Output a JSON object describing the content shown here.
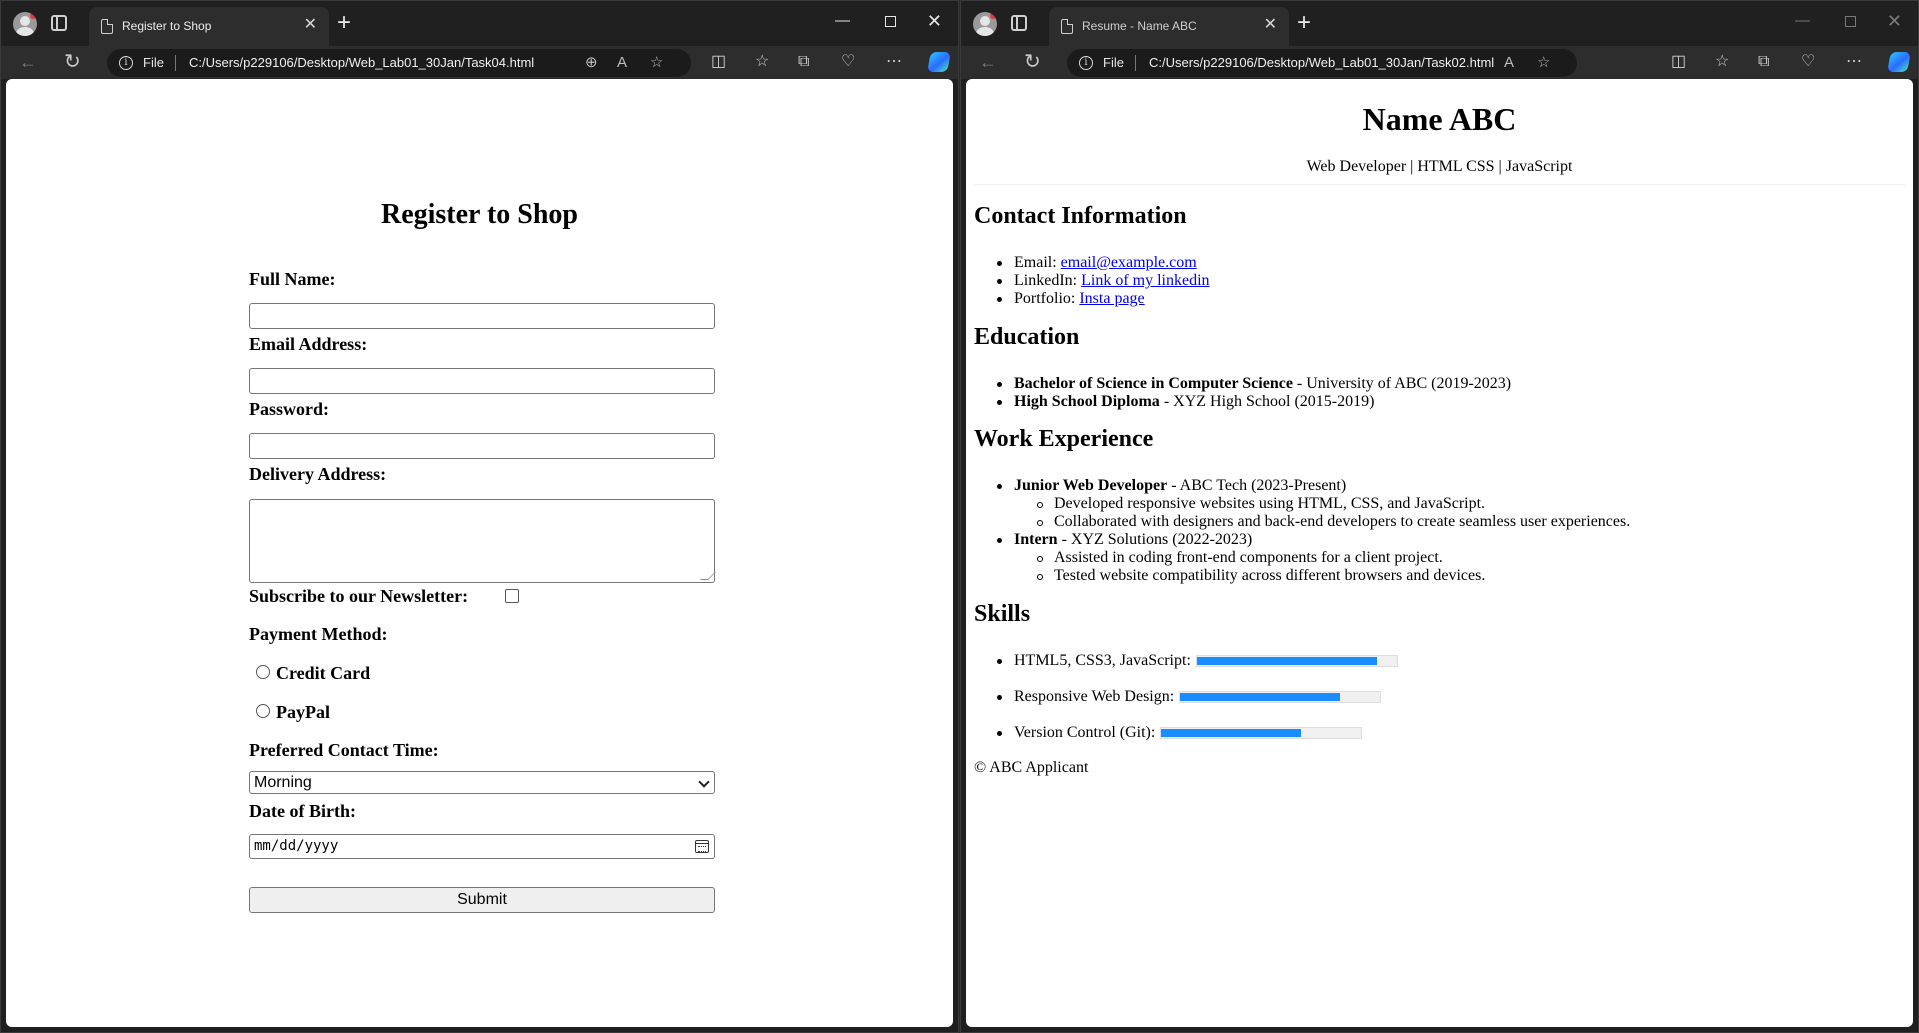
{
  "left_window": {
    "tab_title": "Register to Shop",
    "file_label": "File",
    "url": "C:/Users/p229106/Desktop/Web_Lab01_30Jan/Task04.html",
    "form": {
      "title": "Register to Shop",
      "full_name_label": "Full Name:",
      "full_name_value": "",
      "email_label": "Email Address:",
      "email_value": "",
      "password_label": "Password:",
      "password_value": "",
      "address_label": "Delivery Address:",
      "address_value": "",
      "newsletter_label": "Subscribe to our Newsletter:",
      "newsletter_checked": false,
      "payment_label": "Payment Method:",
      "payment_options": [
        "Credit Card",
        "PayPal"
      ],
      "contact_time_label": "Preferred Contact Time:",
      "contact_time_value": "Morning",
      "dob_label": "Date of Birth:",
      "dob_placeholder": "mm/dd/yyyy",
      "submit_label": "Submit"
    }
  },
  "right_window": {
    "tab_title": "Resume - Name ABC",
    "file_label": "File",
    "url": "C:/Users/p229106/Desktop/Web_Lab01_30Jan/Task02.html",
    "resume": {
      "name": "Name ABC",
      "subtitle": "Web Developer | HTML CSS | JavaScript",
      "contact_heading": "Contact Information",
      "contact": [
        {
          "label": "Email: ",
          "link": "email@example.com"
        },
        {
          "label": "LinkedIn: ",
          "link": "Link of my linkedin"
        },
        {
          "label": "Portfolio: ",
          "link": "Insta page"
        }
      ],
      "education_heading": "Education",
      "education": [
        {
          "degree": "Bachelor of Science in Computer Science",
          "detail": " - University of ABC (2019-2023)"
        },
        {
          "degree": "High School Diploma",
          "detail": " - XYZ High School (2015-2019)"
        }
      ],
      "work_heading": "Work Experience",
      "work": [
        {
          "role": "Junior Web Developer",
          "detail": " - ABC Tech (2023-Present)",
          "points": [
            "Developed responsive websites using HTML, CSS, and JavaScript.",
            "Collaborated with designers and back-end developers to create seamless user experiences."
          ]
        },
        {
          "role": "Intern",
          "detail": " - XYZ Solutions (2022-2023)",
          "points": [
            "Assisted in coding front-end components for a client project.",
            "Tested website compatibility across different browsers and devices."
          ]
        }
      ],
      "skills_heading": "Skills",
      "skills": [
        {
          "name": "HTML5, CSS3, JavaScript:",
          "level": 0.9
        },
        {
          "name": "Responsive Web Design:",
          "level": 0.8
        },
        {
          "name": "Version Control (Git):",
          "level": 0.7
        }
      ],
      "footer": "© ABC Applicant"
    }
  },
  "colors": {
    "chrome_dark": "#202020",
    "toolbar": "#2d2d2d",
    "link": "#0000ee",
    "skill_bar": "#1a8cff"
  },
  "icons": [
    "profile-avatar-icon",
    "tab-actions-icon",
    "document-icon",
    "close-icon",
    "plus-icon",
    "minimize-icon",
    "maximize-icon",
    "back-arrow-icon",
    "reload-icon",
    "info-icon",
    "zoom-icon",
    "read-aloud-icon",
    "favorite-star-icon",
    "split-screen-icon",
    "favorites-icon",
    "collections-icon",
    "browser-essentials-icon",
    "more-icon",
    "copilot-icon",
    "calendar-icon",
    "chevron-down-icon"
  ]
}
